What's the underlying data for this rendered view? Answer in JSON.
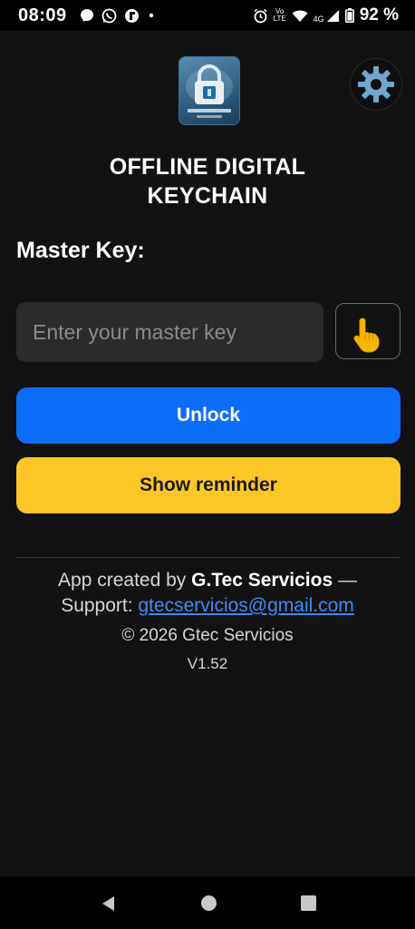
{
  "status_bar": {
    "time": "08:09",
    "left_icons": [
      "messenger-icon",
      "whatsapp-icon",
      "flipboard-icon",
      "dot-icon"
    ],
    "right_icons": [
      "alarm-icon",
      "volte-icon",
      "wifi-icon",
      "4g-signal-icon",
      "battery-icon"
    ],
    "volte_top": "Vo",
    "volte_bottom": "LTE",
    "network": "4G",
    "battery": "92 %"
  },
  "header": {
    "logo_icon": "padlock-keychain-logo",
    "settings_icon": "gear-icon",
    "title_line1": "OFFLINE DIGITAL",
    "title_line2": "KEYCHAIN"
  },
  "form": {
    "label": "Master Key:",
    "input_value": "",
    "input_placeholder": "Enter your master key",
    "biometric_icon": "pointing-hand-icon"
  },
  "buttons": {
    "unlock": "Unlock",
    "reminder": "Show reminder"
  },
  "footer": {
    "created_by_prefix": "App created by ",
    "created_by_name": "G.Tec Servicios",
    "created_by_suffix": " —",
    "support_prefix": "Support: ",
    "support_email": "gtecservicios@gmail.com",
    "copyright": "© 2026 Gtec Servicios",
    "version": "V1.52"
  },
  "colors": {
    "background": "#121212",
    "unlock_button": "#0a6efa",
    "reminder_button": "#fcc626",
    "link": "#3e8af7",
    "input_bg": "#2b2b2b"
  },
  "nav_bar": {
    "icons": [
      "back-icon",
      "home-icon",
      "recents-icon"
    ]
  }
}
